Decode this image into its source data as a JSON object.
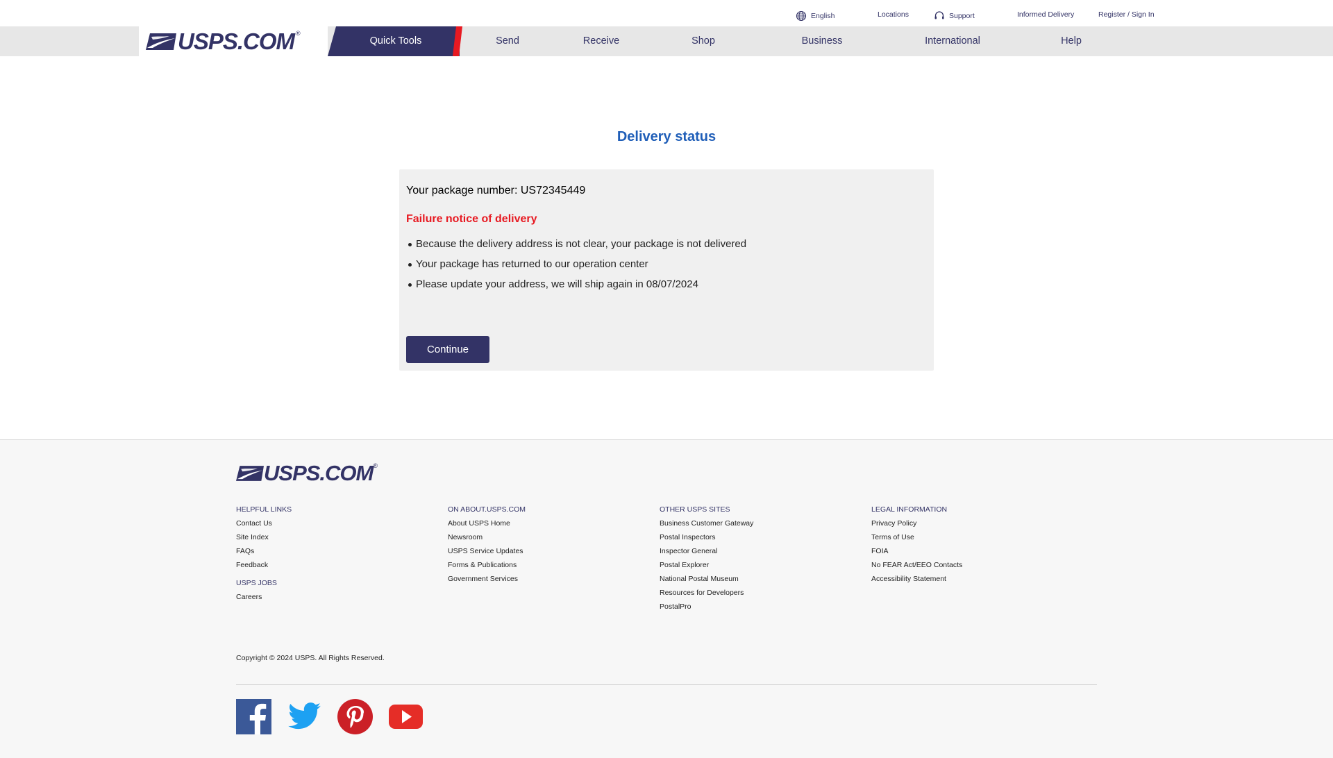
{
  "utility": {
    "language": "English",
    "locations": "Locations",
    "support": "Support",
    "informed_delivery": "Informed Delivery",
    "register": "Register / Sign In"
  },
  "logo": {
    "text": "USPS.COM",
    "reg": "®"
  },
  "nav": {
    "quick_tools": "Quick Tools",
    "send": "Send",
    "receive": "Receive",
    "shop": "Shop",
    "business": "Business",
    "international": "International",
    "help": "Help"
  },
  "main": {
    "title": "Delivery status",
    "package_line": "Your package number: US72345449",
    "failure_title": "Failure notice of delivery",
    "reasons": [
      "Because the delivery address is not clear, your package is not delivered",
      "Your package has returned to our operation center",
      "Please update your address, we will ship again in 08/07/2024"
    ],
    "continue_label": "Continue"
  },
  "footer": {
    "helpful": {
      "heading": "HELPFUL LINKS",
      "links": [
        "Contact Us",
        "Site Index",
        "FAQs",
        "Feedback"
      ],
      "jobs_heading": "USPS JOBS",
      "jobs_links": [
        "Careers"
      ]
    },
    "about": {
      "heading": "ON ABOUT.USPS.COM",
      "links": [
        "About USPS Home",
        "Newsroom",
        "USPS Service Updates",
        "Forms & Publications",
        "Government Services"
      ]
    },
    "other": {
      "heading": "OTHER USPS SITES",
      "links": [
        "Business Customer Gateway",
        "Postal Inspectors",
        "Inspector General",
        "Postal Explorer",
        "National Postal Museum",
        "Resources for Developers",
        "PostalPro"
      ]
    },
    "legal": {
      "heading": "LEGAL INFORMATION",
      "links": [
        "Privacy Policy",
        "Terms of Use",
        "FOIA",
        "No FEAR Act/EEO Contacts",
        "Accessibility Statement"
      ]
    },
    "copyright": "Copyright © 2024 USPS. All Rights Reserved.",
    "social": [
      "facebook-icon",
      "twitter-icon",
      "pinterest-icon",
      "youtube-icon"
    ]
  },
  "colors": {
    "navy": "#333366",
    "red": "#e71921",
    "title_blue": "#1f5eb8",
    "nav_gray": "#e7e7e7",
    "card_gray": "#f0f0f0"
  }
}
